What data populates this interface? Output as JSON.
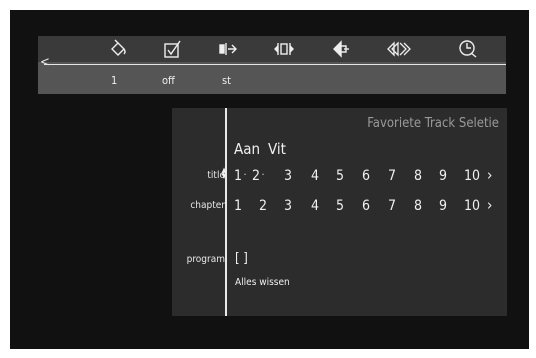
{
  "menu": {
    "back_glyph": "<",
    "icons": [
      {
        "name": "audio-icon"
      },
      {
        "name": "subtitle-icon"
      },
      {
        "name": "angle-icon"
      },
      {
        "name": "zoom-icon"
      },
      {
        "name": "repeat-icon"
      },
      {
        "name": "repeat-ab-icon"
      },
      {
        "name": "time-search-icon"
      }
    ],
    "values": {
      "audio": "1",
      "subtitle": "off",
      "angle": "st"
    }
  },
  "panel": {
    "title": "Favoriete Track Seletie",
    "aan_label": "Aan",
    "uit_label": "Vit",
    "title_row": {
      "label": "title",
      "numbers": [
        "1",
        "2",
        "3",
        "4",
        "5",
        "6",
        "7",
        "8",
        "9",
        "10"
      ],
      "markers": [
        "·",
        "·"
      ],
      "more": "›"
    },
    "chapter_row": {
      "label": "chapter",
      "numbers": [
        "1",
        "2",
        "3",
        "4",
        "5",
        "6",
        "7",
        "8",
        "9",
        "10"
      ],
      "more": "›"
    },
    "program_row": {
      "label": "program",
      "value": "[ ]"
    },
    "hint": "Alles wissen"
  },
  "colors": {
    "screen_bg": "#111111",
    "menu_bg": "#555555",
    "panel_bg": "#2c2c2c",
    "title_text": "#9a9a9a",
    "text": "#f0f0f0"
  }
}
